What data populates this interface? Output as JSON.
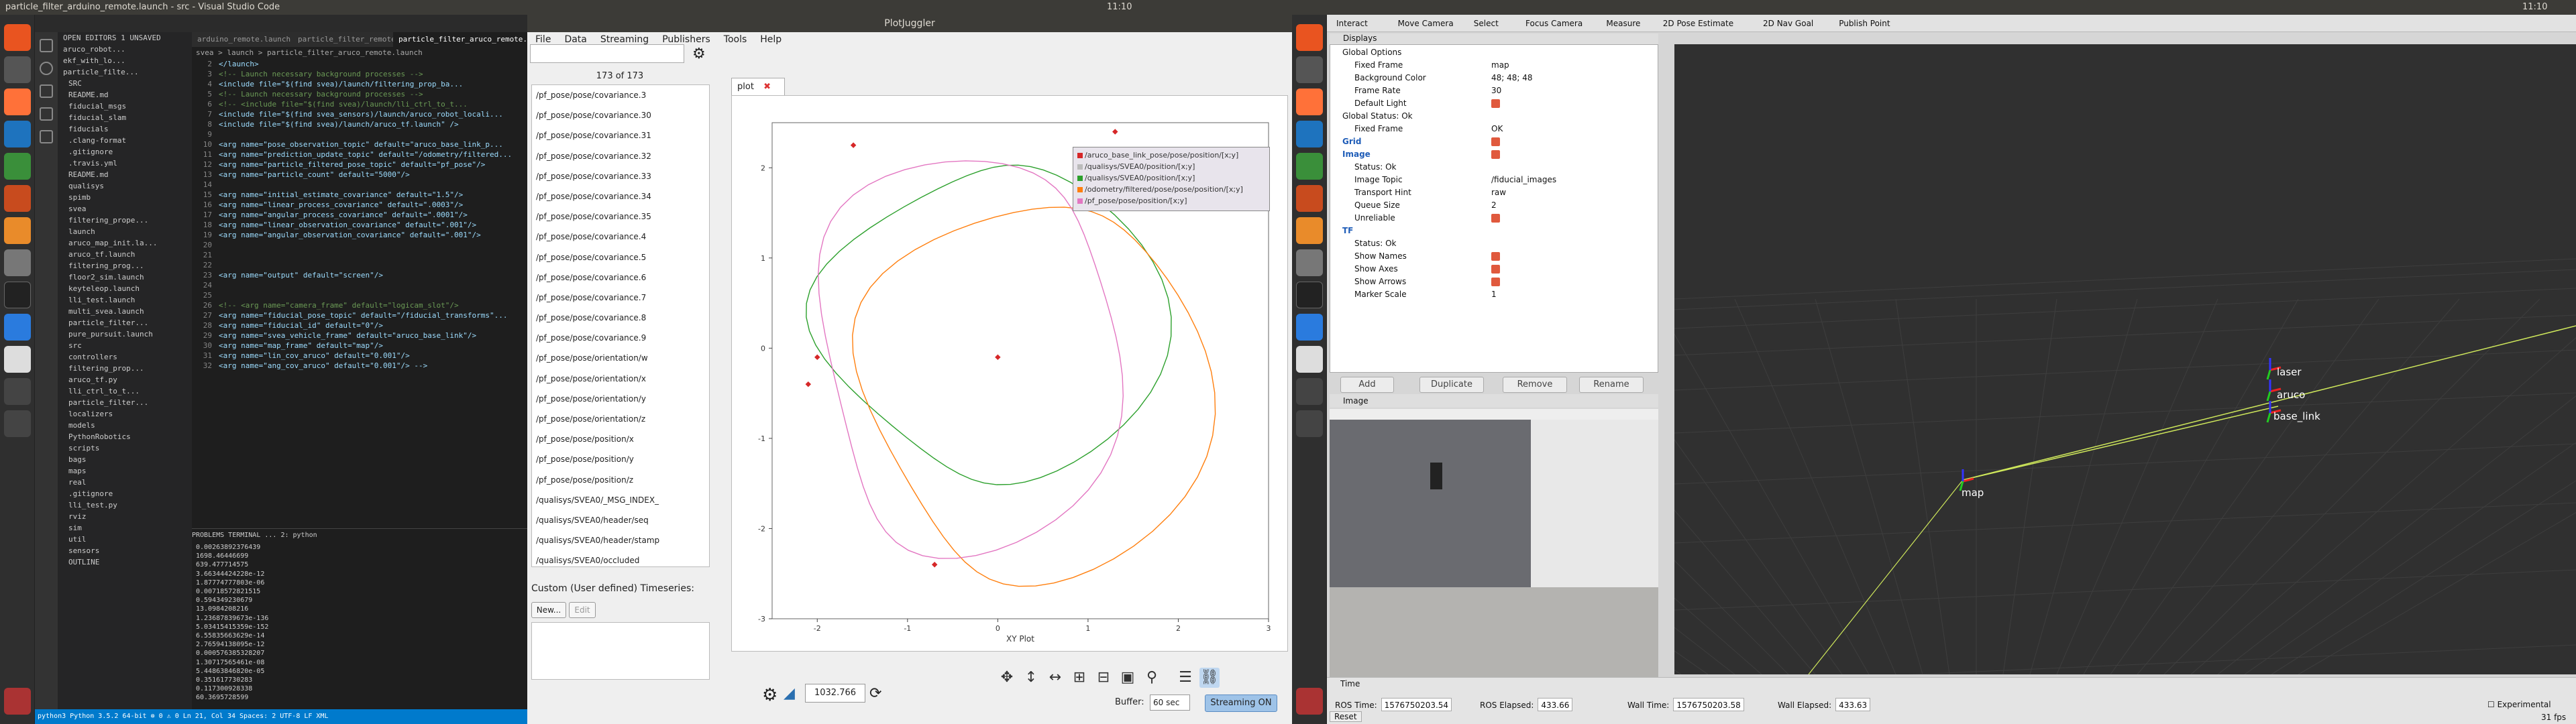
{
  "topbar": {
    "left_title": "particle_filter_arduino_remote.launch - src - Visual Studio Code",
    "left_time": "11:10",
    "right_title": "PlotJuggler",
    "right_time": "11:10"
  },
  "vscode": {
    "title": "particle_filter_arduino_remote.launch - src - Visual Studio Code",
    "tabs": [
      "arduino_remote.launch",
      "particle_filter_remote.py",
      "particle_filter_aruco_remote.launch"
    ],
    "breadcrumb": "svea > launch > particle_filter_aruco_remote.launch",
    "sidebar": [
      "OPEN EDITORS 1 UNSAVED",
      "aruco_robot...",
      "ekf_with_lo...",
      "particle_filte...",
      "SRC",
      "README.md",
      "fiducial_msgs",
      "fiducial_slam",
      "fiducials",
      ".clang-format",
      ".gitignore",
      ".travis.yml",
      "README.md",
      "qualisys",
      "spimb",
      "svea",
      "filtering_prope...",
      "launch",
      "aruco_map_init.la...",
      "aruco_tf.launch",
      "filtering_prog...",
      "floor2_sim.launch",
      "keyteleop.launch",
      "lli_test.launch",
      "multi_svea.launch",
      "particle_filter...",
      "pure_pursuit.launch",
      "src",
      "controllers",
      "filtering_prop...",
      "aruco_tf.py",
      "lli_ctrl_to_t...",
      "particle_filter...",
      "localizers",
      "models",
      "PythonRobotics",
      "scripts",
      "bags",
      "maps",
      "real",
      ".gitignore",
      "lli_test.py",
      "rviz",
      "sim",
      "util",
      "sensors",
      "OUTLINE"
    ],
    "code": [
      "</launch>",
      "<!-- Launch necessary background processes -->",
      "<include file=\"$(find svea)/launch/filtering_prop_ba...",
      "<!-- Launch necessary background processes -->",
      "<!-- <include file=\"$(find svea)/launch/lli_ctrl_to_t...",
      "<include file=\"$(find svea_sensors)/launch/aruco_robot_locali...",
      "<include file=\"$(find svea)/launch/aruco_tf.launch\" />",
      "",
      "<arg name=\"pose_observation_topic\" default=\"aruco_base_link_p...",
      "<arg name=\"prediction_update_topic\" default=\"/odometry/filtered...",
      "<arg name=\"particle_filtered_pose_topic\" default=\"pf_pose\"/>",
      "<arg name=\"particle_count\" default=\"5000\"/>",
      "",
      "<arg name=\"initial_estimate_covariance\" default=\"1.5\"/>",
      "<arg name=\"linear_process_covariance\" default=\".0003\"/>",
      "<arg name=\"angular_process_covariance\" default=\".0001\"/>",
      "<arg name=\"linear_observation_covariance\" default=\".001\"/>",
      "<arg name=\"angular_observation_covariance\" default=\".001\"/>",
      "",
      "",
      "",
      "<arg name=\"output\" default=\"screen\"/>",
      "",
      "",
      "<!-- <arg name=\"camera_frame\" default=\"logicam_slot\"/>",
      "<arg name=\"fiducial_pose_topic\" default=\"/fiducial_transforms\"...",
      "<arg name=\"fiducial_id\" default=\"0\"/>",
      "<arg name=\"svea_vehicle_frame\" default=\"aruco_base_link\"/>",
      "<arg name=\"map_frame\" default=\"map\"/>",
      "<arg name=\"lin_cov_aruco\" default=\"0.001\"/>",
      "<arg name=\"ang_cov_aruco\" default=\"0.001\"/> -->"
    ],
    "term_tabs": "PROBLEMS   TERMINAL   ...   2: python",
    "terminal": [
      "0.00263892376439",
      "1698.46446699",
      "639.477714575",
      "3.66344424228e-12",
      "1.87774777803e-06",
      "0.00718572821515",
      "0.594349230679",
      "13.0984208216",
      "1.23687839673e-136",
      "5.03415415359e-152",
      "6.55835663629e-14",
      "2.76594138095e-12",
      "0.000576385328207",
      "1.30717565461e-08",
      "5.44863846820e-05",
      "0.351617730283",
      "0.117300928338",
      "60.3695728599"
    ],
    "status": "python3   Python 3.5.2 64-bit   ⊗ 0 ⚠ 0   Ln 21, Col 34   Spaces: 2   UTF-8   LF   XML"
  },
  "plotjuggler": {
    "title": "PlotJuggler",
    "menu": [
      "File",
      "Data",
      "Streaming",
      "Publishers",
      "Tools",
      "Help"
    ],
    "count": "173 of 173",
    "list": [
      "/pf_pose/pose/covariance.3",
      "/pf_pose/pose/covariance.30",
      "/pf_pose/pose/covariance.31",
      "/pf_pose/pose/covariance.32",
      "/pf_pose/pose/covariance.33",
      "/pf_pose/pose/covariance.34",
      "/pf_pose/pose/covariance.35",
      "/pf_pose/pose/covariance.4",
      "/pf_pose/pose/covariance.5",
      "/pf_pose/pose/covariance.6",
      "/pf_pose/pose/covariance.7",
      "/pf_pose/pose/covariance.8",
      "/pf_pose/pose/covariance.9",
      "/pf_pose/pose/orientation/w",
      "/pf_pose/pose/orientation/x",
      "/pf_pose/pose/orientation/y",
      "/pf_pose/pose/orientation/z",
      "/pf_pose/pose/position/x",
      "/pf_pose/pose/position/y",
      "/pf_pose/pose/position/z",
      "/qualisys/SVEA0/_MSG_INDEX_",
      "/qualisys/SVEA0/header/seq",
      "/qualisys/SVEA0/header/stamp",
      "/qualisys/SVEA0/occluded"
    ],
    "custom_label": "Custom (User defined) Timeseries:",
    "new_btn": "New...",
    "edit_btn": "Edit",
    "tab_label": "plot",
    "xlabel": "XY Plot",
    "legend": [
      "/aruco_base_link_pose/pose/position/[x;y]",
      "/qualisys/SVEA0/position/[x;y]",
      "/qualisys/SVEA0/position/[x;y]",
      "/odometry/filtered/pose/pose/position/[x;y]",
      "/pf_pose/pose/position/[x;y]"
    ],
    "legend_colors": [
      "#d62728",
      "#bbbbbb",
      "#2ca02c",
      "#ff7f0e",
      "#e377c2"
    ],
    "time_value": "1032.766",
    "buffer_label": "Buffer:",
    "buffer_value": "60 sec",
    "streaming_btn": "Streaming ON",
    "chart_data": {
      "type": "scatter",
      "x_ticks": [
        "-2",
        "-1",
        "0",
        "1",
        "2",
        "3"
      ],
      "y_ticks": [
        "2",
        "1",
        "0",
        "-1",
        "-2",
        "-3"
      ],
      "xlim": [
        -2.5,
        3
      ],
      "ylim": [
        -3,
        2.5
      ],
      "markers": [
        {
          "x": -1.6,
          "y": 2.25
        },
        {
          "x": 1.3,
          "y": 2.4
        },
        {
          "x": -2,
          "y": -0.1
        },
        {
          "x": -2.1,
          "y": -0.4
        },
        {
          "x": -0.7,
          "y": -2.4
        },
        {
          "x": 0,
          "y": -0.1
        }
      ]
    }
  },
  "rviz": {
    "toolbar": [
      "Interact",
      "Move Camera",
      "Select",
      "Focus Camera",
      "Measure",
      "2D Pose Estimate",
      "2D Nav Goal",
      "Publish Point"
    ],
    "displays_title": "Displays",
    "props": [
      {
        "k": "Global Options",
        "v": ""
      },
      {
        "k": "Fixed Frame",
        "v": "map"
      },
      {
        "k": "Background Color",
        "v": "48; 48; 48"
      },
      {
        "k": "Frame Rate",
        "v": "30"
      },
      {
        "k": "Default Light",
        "v": ""
      },
      {
        "k": "Global Status: Ok",
        "v": ""
      },
      {
        "k": "Fixed Frame",
        "v": "OK"
      },
      {
        "k": "Grid",
        "v": ""
      },
      {
        "k": "Image",
        "v": ""
      },
      {
        "k": "Status: Ok",
        "v": ""
      },
      {
        "k": "Image Topic",
        "v": "/fiducial_images"
      },
      {
        "k": "Transport Hint",
        "v": "raw"
      },
      {
        "k": "Queue Size",
        "v": "2"
      },
      {
        "k": "Unreliable",
        "v": ""
      },
      {
        "k": "TF",
        "v": ""
      },
      {
        "k": "Status: Ok",
        "v": ""
      },
      {
        "k": "Show Names",
        "v": ""
      },
      {
        "k": "Show Axes",
        "v": ""
      },
      {
        "k": "Show Arrows",
        "v": ""
      },
      {
        "k": "Marker Scale",
        "v": "1"
      }
    ],
    "buttons": [
      "Add",
      "Duplicate",
      "Remove",
      "Rename"
    ],
    "image_panel": "Image",
    "frames": [
      "laser",
      "aruco",
      "base_link",
      "map"
    ],
    "time_title": "Time",
    "ros_time_label": "ROS Time:",
    "ros_time": "1576750203.54",
    "ros_elapsed_label": "ROS Elapsed:",
    "ros_elapsed": "433.66",
    "wall_time_label": "Wall Time:",
    "wall_time": "1576750203.58",
    "wall_elapsed_label": "Wall Elapsed:",
    "wall_elapsed": "433.63",
    "experimental": "Experimental",
    "reset": "Reset",
    "fps": "31 fps"
  }
}
